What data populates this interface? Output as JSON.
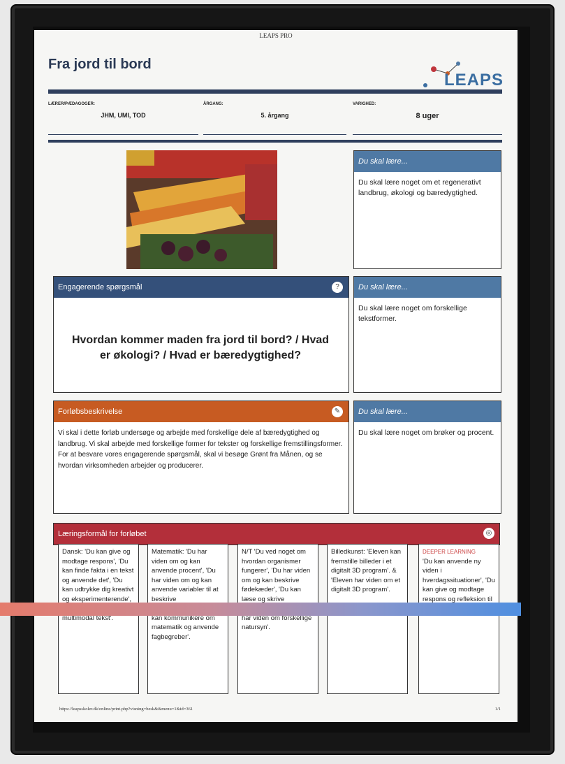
{
  "header": {
    "top_text": "LEAPS PRO",
    "title": "Fra jord til bord",
    "logo_text": "LEAPS"
  },
  "meta": {
    "teacher_label": "LÆRER/PÆDAGOGER:",
    "teacher_value": "JHM, UMI, TOD",
    "year_label": "ÅRGANG:",
    "year_value": "5. årgang",
    "duration_label": "VARIGHED:",
    "duration_value": "8 uger"
  },
  "learn_boxes": [
    {
      "title": "Du skal lære...",
      "text": "Du skal lære noget om et regenerativt landbrug, økologi og bæredygtighed."
    },
    {
      "title": "Du skal lære...",
      "text": "Du skal lære noget om forskellige tekstformer."
    },
    {
      "title": "Du skal lære...",
      "text": "Du skal lære noget om brøker og procent."
    }
  ],
  "engaging": {
    "title": "Engagerende spørgsmål",
    "question": "Hvordan kommer maden fra jord til bord? / Hvad er økologi? / Hvad er bæredygtighed?"
  },
  "description": {
    "title": "Forløbsbeskrivelse",
    "text": "Vi skal i dette forløb undersøge og arbejde med forskellige dele af bæredygtighed og landbrug. Vi skal arbejde med forskellige former for tekster og forskellige fremstillingsformer. For at besvare vores engagerende spørgsmål, skal vi besøge Grønt fra Månen, og se hvordan virksomheden arbejder og producerer."
  },
  "goals": {
    "title": "Læringsformål for forløbet",
    "columns": [
      "Dansk: 'Du kan give og modtage respons', 'Du kan finde fakta i en tekst og anvende det', 'Du kan udtrykke dig kreativt og eksperimenterende', 'Du kan udarbejde en multimodal tekst'.",
      "Matematik: 'Du har viden om og kan anvende procent', 'Du har viden om og kan anvende variabler til at beskrive sammenhænge', 'Du kan kommunikere om matematik og anvende fagbegreber'.",
      "N/T 'Du ved noget om hvordan organismer fungerer', 'Du har viden om og kan beskrive fødekæder', 'Du kan læse og skrive naturfaglige tekster', 'Du har viden om forskellige natursyn'.",
      "Billedkunst: 'Eleven kan fremstille billeder i et digitalt 3D program'. & 'Eleven har viden om et digitalt 3D program'."
    ],
    "deep_title": "DEEPER LEARNING",
    "deep_text": "'Du kan anvende ny viden i hverdagssituationer', 'Du kan give og modtage respons og refleksion til at justere egen læring'."
  },
  "footer": {
    "url": "https://leapsskoler.dk/online/print.php?visning=besk&&menu=1&id=361",
    "page": "1/1"
  },
  "colors": {
    "navy": "#2f3f5d",
    "blue": "#4f79a4",
    "orange": "#c75b22",
    "red": "#b32f3a"
  }
}
